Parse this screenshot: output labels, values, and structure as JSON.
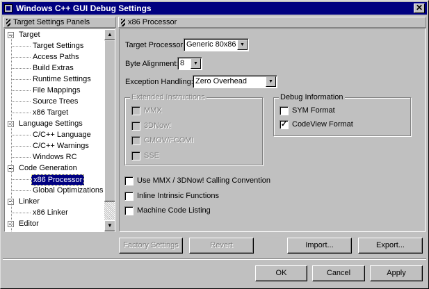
{
  "window": {
    "title": "Windows C++ GUI Debug Settings",
    "close_glyph": "✕"
  },
  "left_panel": {
    "header": "Target Settings Panels",
    "items": [
      {
        "label": "Target",
        "level": 0
      },
      {
        "label": "Target Settings",
        "level": 1
      },
      {
        "label": "Access Paths",
        "level": 1
      },
      {
        "label": "Build Extras",
        "level": 1
      },
      {
        "label": "Runtime Settings",
        "level": 1
      },
      {
        "label": "File Mappings",
        "level": 1
      },
      {
        "label": "Source Trees",
        "level": 1
      },
      {
        "label": "x86 Target",
        "level": 1
      },
      {
        "label": "Language Settings",
        "level": 0
      },
      {
        "label": "C/C++ Language",
        "level": 1
      },
      {
        "label": "C/C++ Warnings",
        "level": 1
      },
      {
        "label": "Windows RC",
        "level": 1
      },
      {
        "label": "Code Generation",
        "level": 0
      },
      {
        "label": "x86 Processor",
        "level": 1,
        "selected": true
      },
      {
        "label": "Global Optimizations",
        "level": 1
      },
      {
        "label": "Linker",
        "level": 0
      },
      {
        "label": "x86 Linker",
        "level": 1
      },
      {
        "label": "Editor",
        "level": 0
      }
    ],
    "scroll_up": "▲",
    "scroll_down": "▼"
  },
  "right_panel": {
    "header": "x86 Processor",
    "target_processor": {
      "label": "Target Processor:",
      "value": "Generic 80x86"
    },
    "byte_alignment": {
      "label": "Byte Alignment:",
      "value": "8"
    },
    "exception_handling": {
      "label": "Exception Handling:",
      "value": "Zero Overhead"
    },
    "dropdown_glyph": "▼",
    "extended_instructions": {
      "title": "Extended Instructions",
      "options": [
        {
          "label": "MMX",
          "checked": false
        },
        {
          "label": "3DNow!",
          "checked": false
        },
        {
          "label": "CMOV/FCOMI",
          "checked": false
        },
        {
          "label": "SSE",
          "checked": false
        }
      ]
    },
    "debug_information": {
      "title": "Debug Information",
      "options": [
        {
          "label": "SYM Format",
          "checked": false
        },
        {
          "label": "CodeView Format",
          "checked": true
        }
      ]
    },
    "options": [
      {
        "label": "Use MMX / 3DNow! Calling Convention",
        "checked": false
      },
      {
        "label": "Inline Intrinsic Functions",
        "checked": false
      },
      {
        "label": "Machine Code Listing",
        "checked": false
      }
    ],
    "check_glyph": "✓"
  },
  "buttons": {
    "factory_settings": "Factory Settings",
    "revert": "Revert",
    "import": "Import...",
    "export": "Export...",
    "ok": "OK",
    "cancel": "Cancel",
    "apply": "Apply"
  }
}
